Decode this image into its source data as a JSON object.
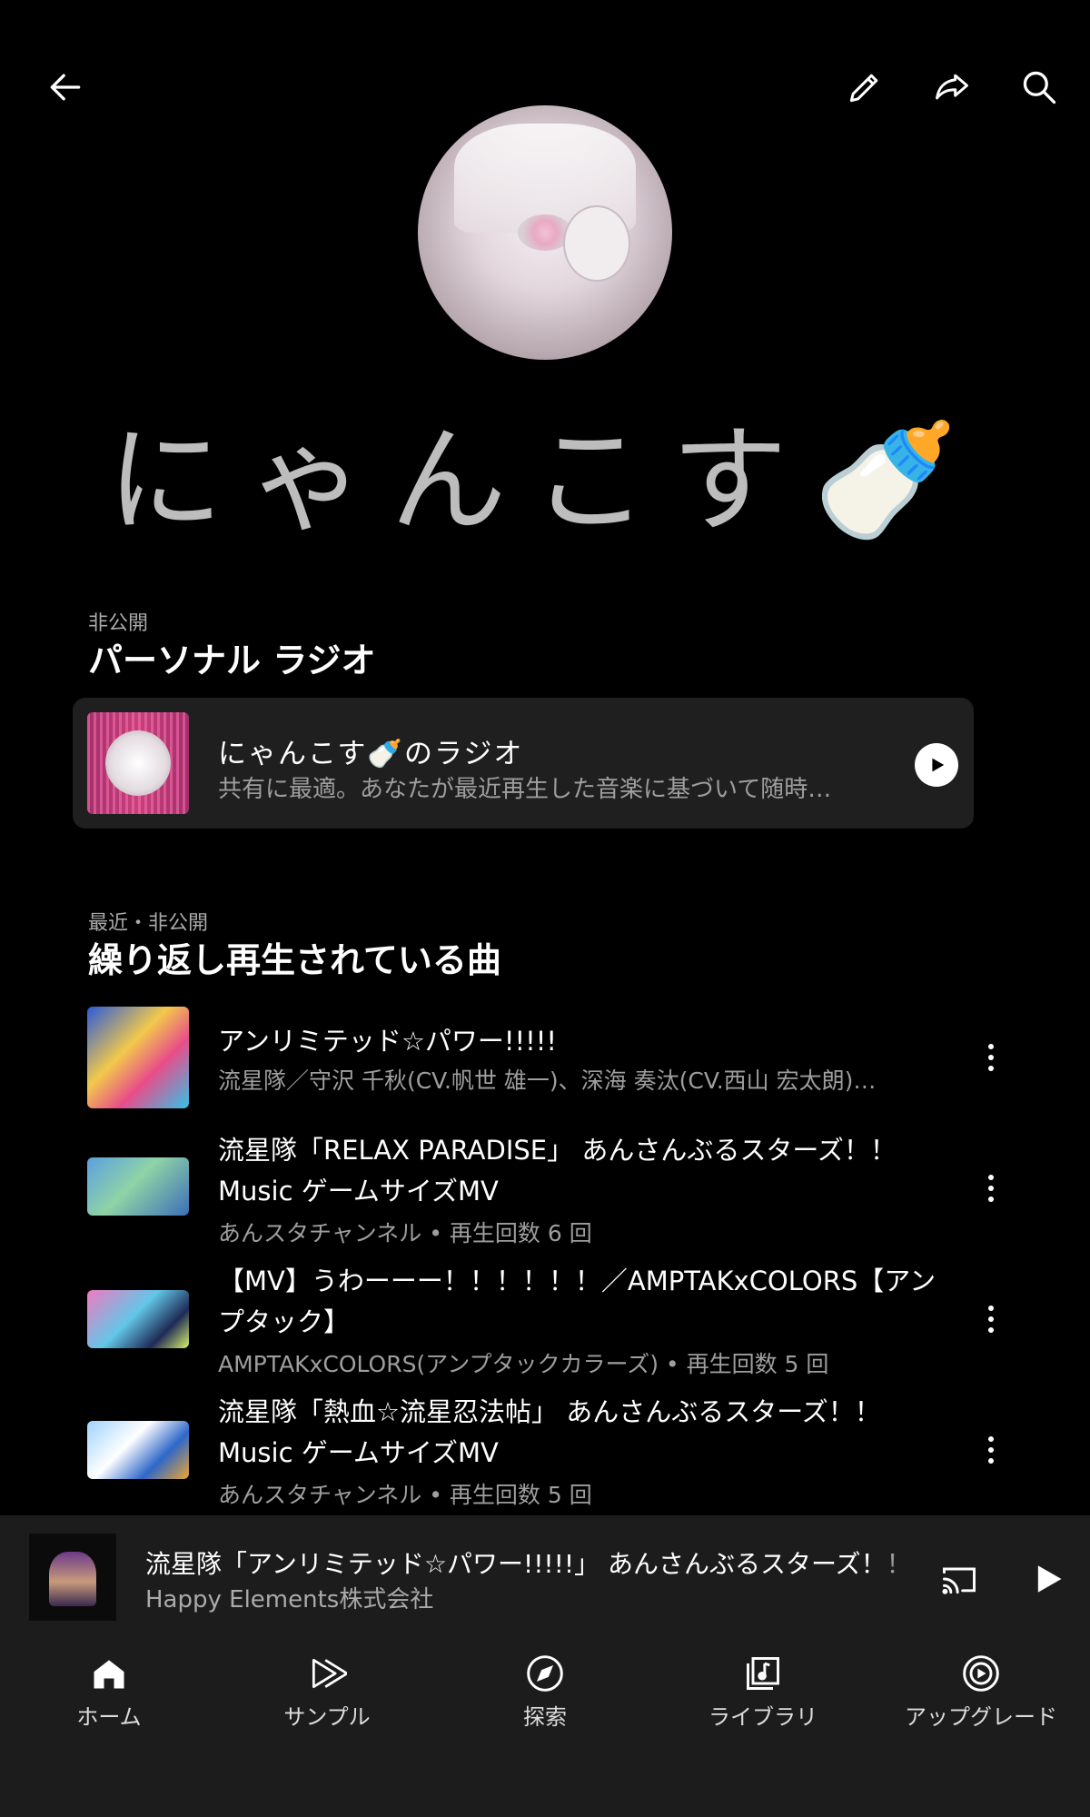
{
  "header": {
    "back_icon": "arrow-left-icon",
    "edit_icon": "pencil-icon",
    "share_icon": "share-arrow-icon",
    "search_icon": "search-icon"
  },
  "profile": {
    "name": "にゃんこす🍼"
  },
  "radio_section": {
    "subtitle": "非公開",
    "title": "パーソナル ラジオ",
    "card": {
      "title": "にゃんこす🍼のラジオ",
      "description": "共有に最適。あなたが最近再生した音楽に基づいて随時…"
    }
  },
  "repeat_section": {
    "subtitle": "最近・非公開",
    "title": "繰り返し再生されている曲",
    "tracks": [
      {
        "title": "アンリミテッド☆パワー!!!!!",
        "subtitle": "流星隊／守沢 千秋(CV.帆世 雄一)、深海 奏汰(CV.西山 宏太朗)…"
      },
      {
        "title": "流星隊「RELAX PARADISE」 あんさんぶるスターズ！！Music ゲームサイズMV",
        "subtitle": "あんスタチャンネル • 再生回数 6 回"
      },
      {
        "title": "【MV】うわーーー！！！！！！／AMPTAKxCOLORS【アンプタック】",
        "subtitle": "AMPTAKxCOLORS(アンプタックカラーズ) • 再生回数 5 回"
      },
      {
        "title": "流星隊「熱血☆流星忍法帖」 あんさんぶるスターズ！！Music ゲームサイズMV",
        "subtitle": "あんスタチャンネル • 再生回数 5 回"
      }
    ]
  },
  "mini_player": {
    "title": "流星隊「アンリミテッド☆パワー!!!!!」 あんさんぶるスターズ！！ |",
    "artist": "Happy Elements株式会社",
    "cast_icon": "cast-icon",
    "play_icon": "play-icon"
  },
  "bottom_nav": {
    "items": [
      {
        "label": "ホーム",
        "icon": "home-icon"
      },
      {
        "label": "サンプル",
        "icon": "samples-icon"
      },
      {
        "label": "探索",
        "icon": "compass-icon"
      },
      {
        "label": "ライブラリ",
        "icon": "library-icon"
      },
      {
        "label": "アップグレード",
        "icon": "upgrade-icon"
      }
    ]
  }
}
